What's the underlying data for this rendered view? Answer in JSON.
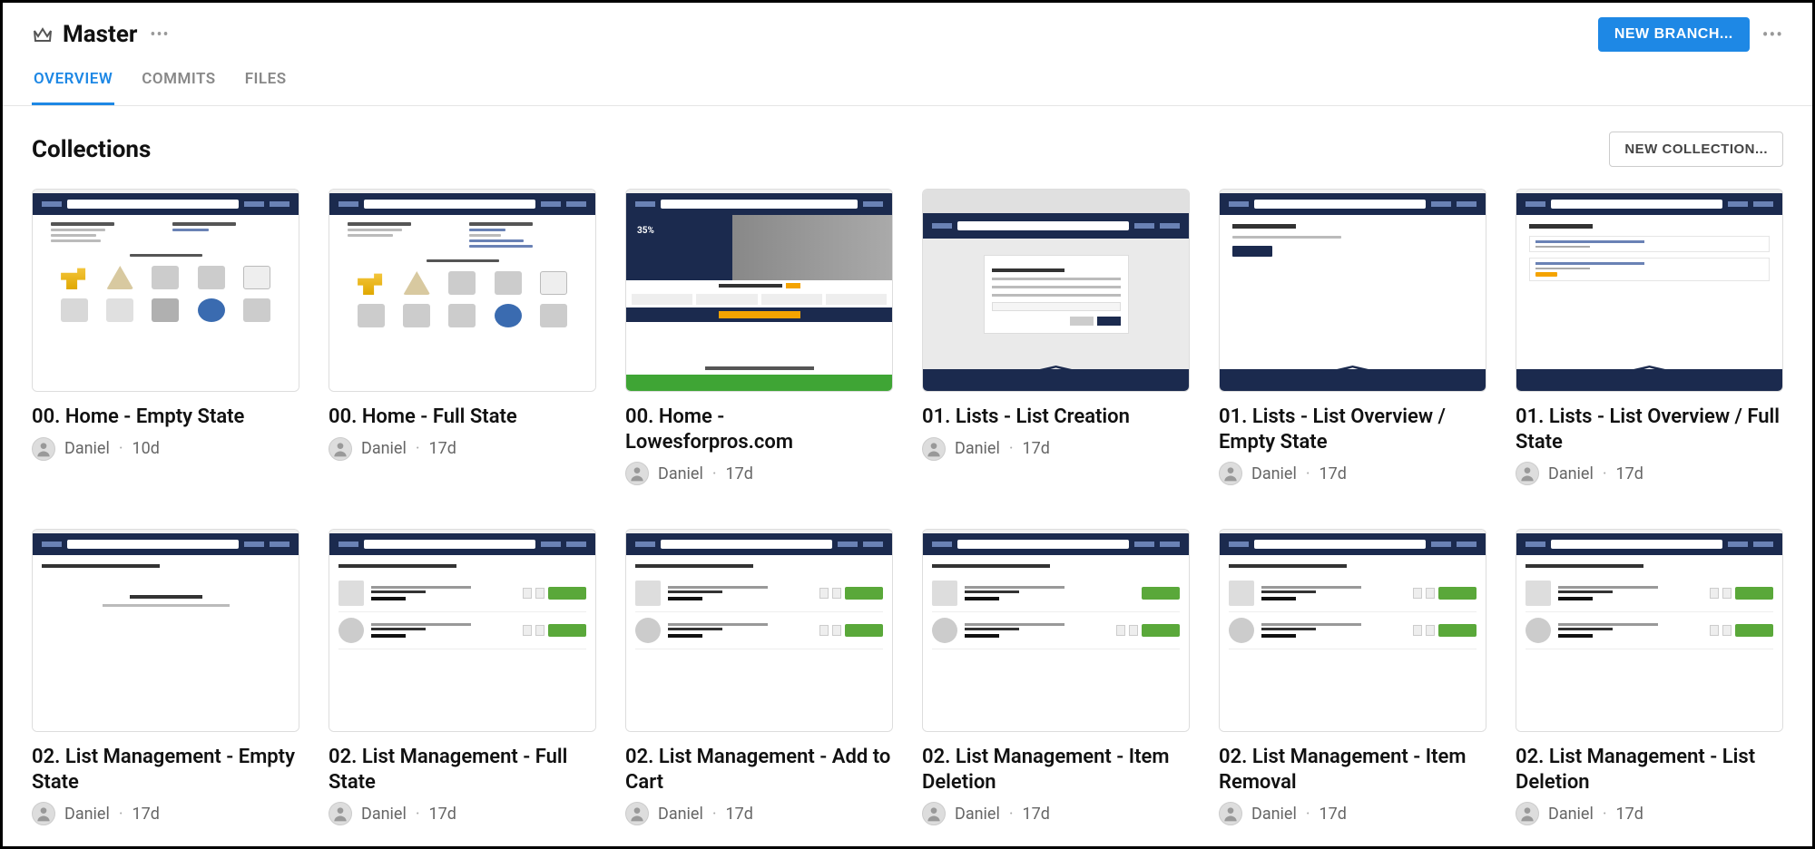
{
  "header": {
    "title": "Master",
    "new_branch_label": "NEW BRANCH..."
  },
  "tabs": {
    "overview": "OVERVIEW",
    "commits": "COMMITS",
    "files": "FILES"
  },
  "section": {
    "title": "Collections",
    "new_collection_label": "NEW COLLECTION..."
  },
  "cards": [
    {
      "title": "00. Home - Empty State",
      "author": "Daniel",
      "age": "10d"
    },
    {
      "title": "00. Home - Full State",
      "author": "Daniel",
      "age": "17d"
    },
    {
      "title": "00. Home - Lowesforpros.com",
      "author": "Daniel",
      "age": "17d"
    },
    {
      "title": "01. Lists - List Creation",
      "author": "Daniel",
      "age": "17d"
    },
    {
      "title": "01. Lists - List Overview / Empty State",
      "author": "Daniel",
      "age": "17d"
    },
    {
      "title": "01. Lists - List Overview / Full State",
      "author": "Daniel",
      "age": "17d"
    },
    {
      "title": "02. List Management - Empty State",
      "author": "Daniel",
      "age": "17d"
    },
    {
      "title": "02. List Management - Full State",
      "author": "Daniel",
      "age": "17d"
    },
    {
      "title": "02. List Management - Add to Cart",
      "author": "Daniel",
      "age": "17d"
    },
    {
      "title": "02. List Management - Item Deletion",
      "author": "Daniel",
      "age": "17d"
    },
    {
      "title": "02. List Management - Item Removal",
      "author": "Daniel",
      "age": "17d"
    },
    {
      "title": "02. List Management - List Deletion",
      "author": "Daniel",
      "age": "17d"
    }
  ]
}
